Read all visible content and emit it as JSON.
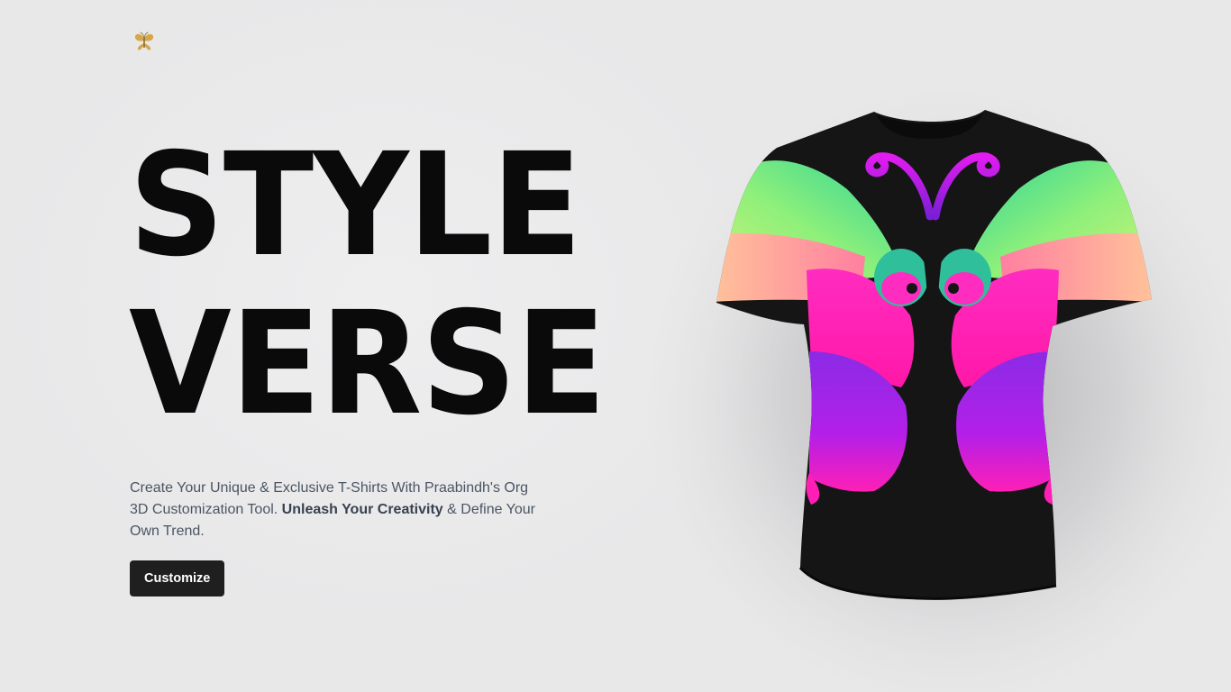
{
  "header": {
    "logo_icon": "butterfly-logo-icon"
  },
  "hero": {
    "title_line1": "STYLE",
    "title_line2": "VERSE",
    "desc_part1": "Create Your Unique & Exclusive T-Shirts With Praabindh's Org 3D Customization Tool. ",
    "desc_bold": "Unleash Your Creativity",
    "desc_part2": " & Define Your Own Trend.",
    "cta_label": "Customize"
  },
  "showcase": {
    "product": "t-shirt",
    "design": "butterfly",
    "colors": {
      "shirt": "#151515",
      "green": "#4ee09a",
      "pink": "#ff1fb6",
      "purple": "#7a1fd6",
      "peach": "#ff9a86",
      "magenta": "#d81cf0"
    }
  },
  "theme": {
    "background": "#e8e8e9",
    "text_dark": "#0a0a0a",
    "text_muted": "#4b5563",
    "button_bg": "#1f1f1f",
    "button_text": "#ffffff"
  }
}
